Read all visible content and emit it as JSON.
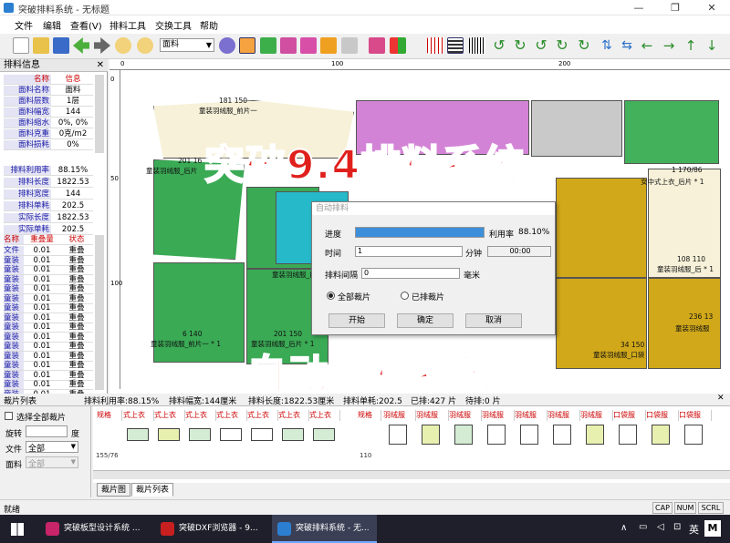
{
  "window": {
    "title": "突破排料系统 - 无标题",
    "min": "—",
    "max": "❐",
    "close": "✕"
  },
  "menu": [
    "文件",
    "编辑",
    "查看(V)",
    "排料工具",
    "交换工具",
    "帮助"
  ],
  "toolbar": {
    "fabric_value": "面料"
  },
  "panel_info": {
    "title": "排料信息",
    "close": "✕",
    "header": {
      "k": "名称",
      "v": "信息"
    },
    "rows": [
      {
        "k": "面料名称",
        "v": "面料"
      },
      {
        "k": "面料层数",
        "v": "1层"
      },
      {
        "k": "面料幅宽",
        "v": "144"
      },
      {
        "k": "面料缩水",
        "v": "0%, 0%"
      },
      {
        "k": "面料克重",
        "v": "0克/m2"
      },
      {
        "k": "面料损耗",
        "v": "0%"
      }
    ],
    "rows2": [
      {
        "k": "排料利用率",
        "v": "88.15%"
      },
      {
        "k": "排料长度",
        "v": "1822.53"
      },
      {
        "k": "排料宽度",
        "v": "144"
      },
      {
        "k": "排料单耗",
        "v": "202.5"
      },
      {
        "k": "实际长度",
        "v": "1822.53"
      },
      {
        "k": "实际单耗",
        "v": "202.5"
      }
    ],
    "grid_header": {
      "a": "名称",
      "b": "重叠量",
      "c": "状态"
    },
    "grid_rows": [
      {
        "a": "文件",
        "b": "0.01",
        "c": "重叠"
      },
      {
        "a": "童装",
        "b": "0.01",
        "c": "重叠"
      },
      {
        "a": "童装",
        "b": "0.01",
        "c": "重叠"
      },
      {
        "a": "童装",
        "b": "0.01",
        "c": "重叠"
      },
      {
        "a": "童装",
        "b": "0.01",
        "c": "重叠"
      },
      {
        "a": "童装",
        "b": "0.01",
        "c": "重叠"
      },
      {
        "a": "童装",
        "b": "0.01",
        "c": "重叠"
      },
      {
        "a": "童装",
        "b": "0.01",
        "c": "重叠"
      },
      {
        "a": "童装",
        "b": "0.01",
        "c": "重叠"
      },
      {
        "a": "童装",
        "b": "0.01",
        "c": "重叠"
      },
      {
        "a": "童装",
        "b": "0.01",
        "c": "重叠"
      },
      {
        "a": "童装",
        "b": "0.01",
        "c": "重叠"
      },
      {
        "a": "童装",
        "b": "0.01",
        "c": "重叠"
      },
      {
        "a": "童装",
        "b": "0.01",
        "c": "重叠"
      },
      {
        "a": "童装",
        "b": "0.01",
        "c": "重叠"
      },
      {
        "a": "童装",
        "b": "0.01",
        "c": "重叠"
      }
    ]
  },
  "ruler": {
    "h": [
      "0",
      "100",
      "200"
    ],
    "v": [
      "0",
      "50",
      "100"
    ]
  },
  "pieces": [
    {
      "label": "181  150",
      "sub": "童装羽绒服_前片一"
    },
    {
      "label": "201  16",
      "sub": "童装羽绒服_后片"
    },
    {
      "label": "1  170/86",
      "sub": "女中式上衣_后片 * 1"
    },
    {
      "label": "108  110",
      "sub": "童装羽绒服_后 * 1"
    },
    {
      "label": "童装羽绒服_口袋",
      "sub": ""
    },
    {
      "label": "6  140",
      "sub": "童装羽绒服_前片一 * 1"
    },
    {
      "label": "201  150",
      "sub": "童装羽绒服_后片 * 1"
    },
    {
      "label": "236  13",
      "sub": "童装羽绒服"
    },
    {
      "label": "34  150",
      "sub": "童装羽绒服_口袋"
    }
  ],
  "overlays": {
    "line1": "突破9.4排料系统",
    "line2": "自动排料系统"
  },
  "dialog": {
    "title": "自动排料",
    "progress_label": "进度",
    "progress": 1.0,
    "rate_label": "利用率",
    "rate_value": "88.10%",
    "time_label": "时间",
    "time_value": "1",
    "minute_label": "分钟",
    "elapsed": "00:00",
    "gap_label": "排料间隔",
    "gap_value": "0",
    "gap_unit": "毫米",
    "radio_all": "全部裁片",
    "radio_placed": "已排裁片",
    "btn_start": "开始",
    "btn_ok": "确定",
    "btn_cancel": "取消"
  },
  "statbar": {
    "pieces_list": "裁片列表",
    "rate": "排料利用率:88.15%",
    "width": "排料幅宽:144厘米",
    "length": "排料长度:1822.53厘米",
    "unit": "排料单耗:202.5",
    "placed": "已排:427 片",
    "pending": "待排:0 片"
  },
  "bottom_left": {
    "select_all": "选择全部裁片",
    "rotate": "旋转",
    "deg": "度",
    "file_label": "文件",
    "file_value": "全部",
    "fabric_label": "面料",
    "fabric_value": "全部"
  },
  "grid": {
    "spec_label": "规格",
    "spec2_label": "规格",
    "cols1": [
      "式上衣",
      "式上衣",
      "式上衣",
      "式上衣",
      "式上衣",
      "式上衣",
      "式上衣"
    ],
    "cols2": [
      "羽绒服",
      "羽绒服",
      "羽绒服",
      "羽绒服",
      "羽绒服",
      "羽绒服",
      "羽绒服",
      "口袋服",
      "口袋服",
      "口袋服"
    ],
    "size1": "155/76",
    "size2": "110"
  },
  "tabs": [
    "裁片图",
    "裁片列表"
  ],
  "status": {
    "ready": "就绪",
    "cap": "CAP",
    "num": "NUM",
    "scrl": "SCRL"
  },
  "taskbar": {
    "items": [
      "突破板型设计系统 ...",
      "突破DXF浏览器 - 9...",
      "突破排料系统 - 无..."
    ],
    "lang": "英",
    "ime": "M"
  }
}
